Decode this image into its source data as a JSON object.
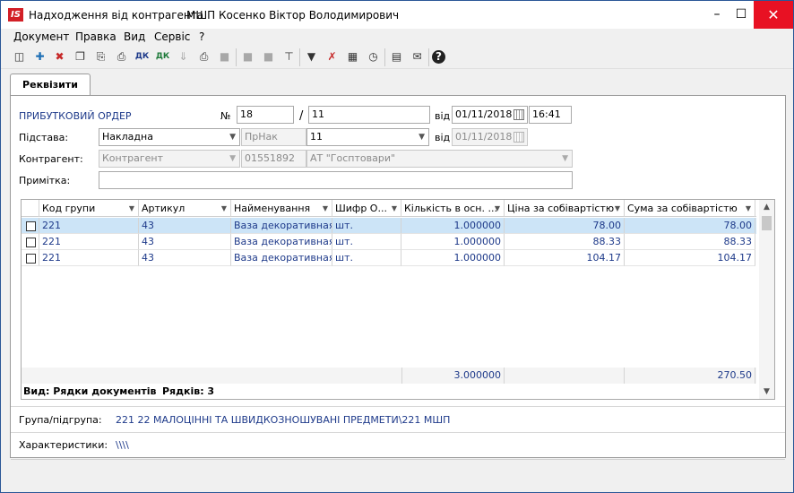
{
  "window": {
    "title": "Надходження від контрагента",
    "user": "МШП Косенко Віктор Володимирович",
    "logo_text": "IS",
    "accent": "#d21f26"
  },
  "menu": [
    "Документ",
    "Правка",
    "Вид",
    "Сервіс",
    "?"
  ],
  "toolbar_icons": [
    "copy-record-icon",
    "add-icon",
    "delete-icon",
    "duplicate-icon",
    "paste-icon",
    "paste-special-icon",
    "debit-credit-icon",
    "debit-credit-check-icon",
    "sort-down-icon",
    "print-icon",
    "export-icon",
    "disabled-action-1-icon",
    "disabled-action-2-icon",
    "tree-icon",
    "filter-icon",
    "clear-filter-icon",
    "table-icon",
    "history-icon",
    "calculator-icon",
    "email-icon",
    "help-icon"
  ],
  "tab": {
    "label": "Реквізити"
  },
  "form": {
    "doc_type": "ПРИБУТКОВИЙ ОРДЕР",
    "number_label": "№",
    "number_prefix": "18",
    "slash": "/",
    "number_suffix": "11",
    "date_label": "від",
    "date": "01/11/2018",
    "time": "16:41",
    "basis_label": "Підстава:",
    "basis_value": "Накладна",
    "basis_code": "ПрНак",
    "basis_number": "11",
    "basis_date_label": "від",
    "basis_date": "01/11/2018",
    "counterparty_label": "Контрагент:",
    "counterparty_type": "Контрагент",
    "counterparty_code": "01551892",
    "counterparty_name": "АТ \"Госптовари\"",
    "note_label": "Примітка:",
    "note_value": ""
  },
  "grid": {
    "columns": [
      "Код групи",
      "Артикул",
      "Найменування",
      "Шифр О...",
      "Кількість в осн. ...",
      "Ціна за собівартістю",
      "Сума за собівартістю"
    ],
    "rows": [
      {
        "code": "221",
        "article": "43",
        "name": "Ваза декоративная",
        "unit": "шт.",
        "qty": "1.000000",
        "price": "78.00",
        "sum": "78.00"
      },
      {
        "code": "221",
        "article": "43",
        "name": "Ваза декоративная",
        "unit": "шт.",
        "qty": "1.000000",
        "price": "88.33",
        "sum": "88.33"
      },
      {
        "code": "221",
        "article": "43",
        "name": "Ваза декоративная",
        "unit": "шт.",
        "qty": "1.000000",
        "price": "104.17",
        "sum": "104.17"
      }
    ],
    "total_qty": "3.000000",
    "total_sum": "270.50",
    "view_label": "Вид: Рядки документів",
    "rows_label": "Рядків: 3"
  },
  "footer": {
    "group_label": "Група/підгрупа:",
    "group_value": "221 22 МАЛОЦІННІ ТА ШВИДКОЗНОШУВАНІ ПРЕДМЕТИ\\221 МШП",
    "characteristics_label": "Характеристики:",
    "characteristics_value": "\\\\\\\\"
  }
}
